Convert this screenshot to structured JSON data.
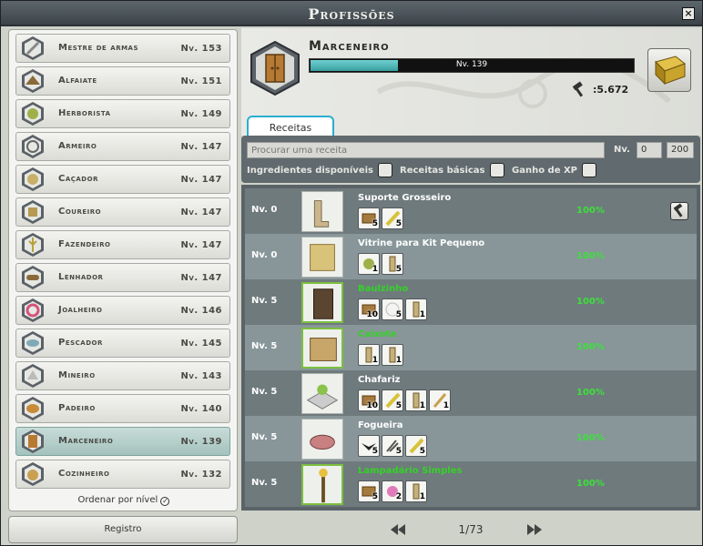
{
  "window": {
    "title": "Profissões",
    "close_label": "×"
  },
  "professions": [
    {
      "name": "Mestre de armas",
      "level": "Nv. 153",
      "icon": "sword-icon"
    },
    {
      "name": "Alfaiate",
      "level": "Nv. 151",
      "icon": "hat-icon"
    },
    {
      "name": "Herborista",
      "level": "Nv. 149",
      "icon": "herb-icon"
    },
    {
      "name": "Armeiro",
      "level": "Nv. 147",
      "icon": "armor-icon"
    },
    {
      "name": "Caçador",
      "level": "Nv. 147",
      "icon": "hunter-icon"
    },
    {
      "name": "Coureiro",
      "level": "Nv. 147",
      "icon": "leather-icon"
    },
    {
      "name": "Fazendeiro",
      "level": "Nv. 147",
      "icon": "wheat-icon"
    },
    {
      "name": "Lenhador",
      "level": "Nv. 147",
      "icon": "log-icon"
    },
    {
      "name": "Joalheiro",
      "level": "Nv. 146",
      "icon": "ring-icon"
    },
    {
      "name": "Pescador",
      "level": "Nv. 145",
      "icon": "fish-icon"
    },
    {
      "name": "Mineiro",
      "level": "Nv. 143",
      "icon": "ore-icon"
    },
    {
      "name": "Padeiro",
      "level": "Nv. 140",
      "icon": "bread-icon"
    },
    {
      "name": "Marceneiro",
      "level": "Nv. 139",
      "icon": "wardrobe-icon",
      "selected": true
    },
    {
      "name": "Cozinheiro",
      "level": "Nv. 132",
      "icon": "food-icon"
    }
  ],
  "sort_label": "Ordenar por nível",
  "registro_label": "Registro",
  "header": {
    "name": "Marceneiro",
    "xp_text": "Nv. 139",
    "xp_fraction": 0.27,
    "score": ":5.672"
  },
  "tab_label": "Receitas",
  "filters": {
    "search_placeholder": "Procurar uma receita",
    "level_label": "Nv.",
    "level_min": "0",
    "level_max": "200",
    "ingredients_label": "Ingredientes disponíveis",
    "basic_label": "Receitas básicas",
    "xp_label": "Ganho de XP"
  },
  "recipes": [
    {
      "level": "Nv. 0",
      "name": "Suporte Grosseiro",
      "green": false,
      "pct": "100%",
      "craft": true,
      "ingredients": [
        {
          "icon": "plank-icon",
          "qty": "5"
        },
        {
          "icon": "feather-icon",
          "qty": "5"
        }
      ]
    },
    {
      "level": "Nv. 0",
      "name": "Vitrine para Kit Pequeno",
      "green": false,
      "pct": "100%",
      "craft": false,
      "ingredients": [
        {
          "icon": "seed-icon",
          "qty": "1"
        },
        {
          "icon": "board-icon",
          "qty": "5"
        }
      ]
    },
    {
      "level": "Nv. 5",
      "name": "Baulzinho",
      "green": true,
      "pct": "100%",
      "craft": false,
      "ingredients": [
        {
          "icon": "plank-icon",
          "qty": "10"
        },
        {
          "icon": "wool-icon",
          "qty": "5"
        },
        {
          "icon": "board-icon",
          "qty": "1"
        }
      ]
    },
    {
      "level": "Nv. 5",
      "name": "Caixote",
      "green": true,
      "pct": "100%",
      "craft": false,
      "ingredients": [
        {
          "icon": "board-icon",
          "qty": "1"
        },
        {
          "icon": "board-icon",
          "qty": "1"
        }
      ]
    },
    {
      "level": "Nv. 5",
      "name": "Chafariz",
      "green": false,
      "pct": "100%",
      "craft": false,
      "ingredients": [
        {
          "icon": "plank-icon",
          "qty": "10"
        },
        {
          "icon": "feather-icon",
          "qty": "5"
        },
        {
          "icon": "board-icon",
          "qty": "1"
        },
        {
          "icon": "stick-icon",
          "qty": "1"
        }
      ]
    },
    {
      "level": "Nv. 5",
      "name": "Fogueira",
      "green": false,
      "pct": "100%",
      "craft": false,
      "ingredients": [
        {
          "icon": "bat-wing-icon",
          "qty": "5"
        },
        {
          "icon": "claw-icon",
          "qty": "5"
        },
        {
          "icon": "feather-icon",
          "qty": "5"
        }
      ]
    },
    {
      "level": "Nv. 5",
      "name": "Lampadário Simples",
      "green": true,
      "pct": "100%",
      "craft": false,
      "ingredients": [
        {
          "icon": "plank-icon",
          "qty": "5"
        },
        {
          "icon": "flower-icon",
          "qty": "2"
        },
        {
          "icon": "board-icon",
          "qty": "1"
        }
      ]
    }
  ],
  "pagination": {
    "text": "1/73"
  },
  "colors": {
    "accent": "#2aaed0",
    "xp_bar": "#3a9ea0",
    "green_text": "#34d226",
    "selected_row": "#a4c2bd"
  }
}
